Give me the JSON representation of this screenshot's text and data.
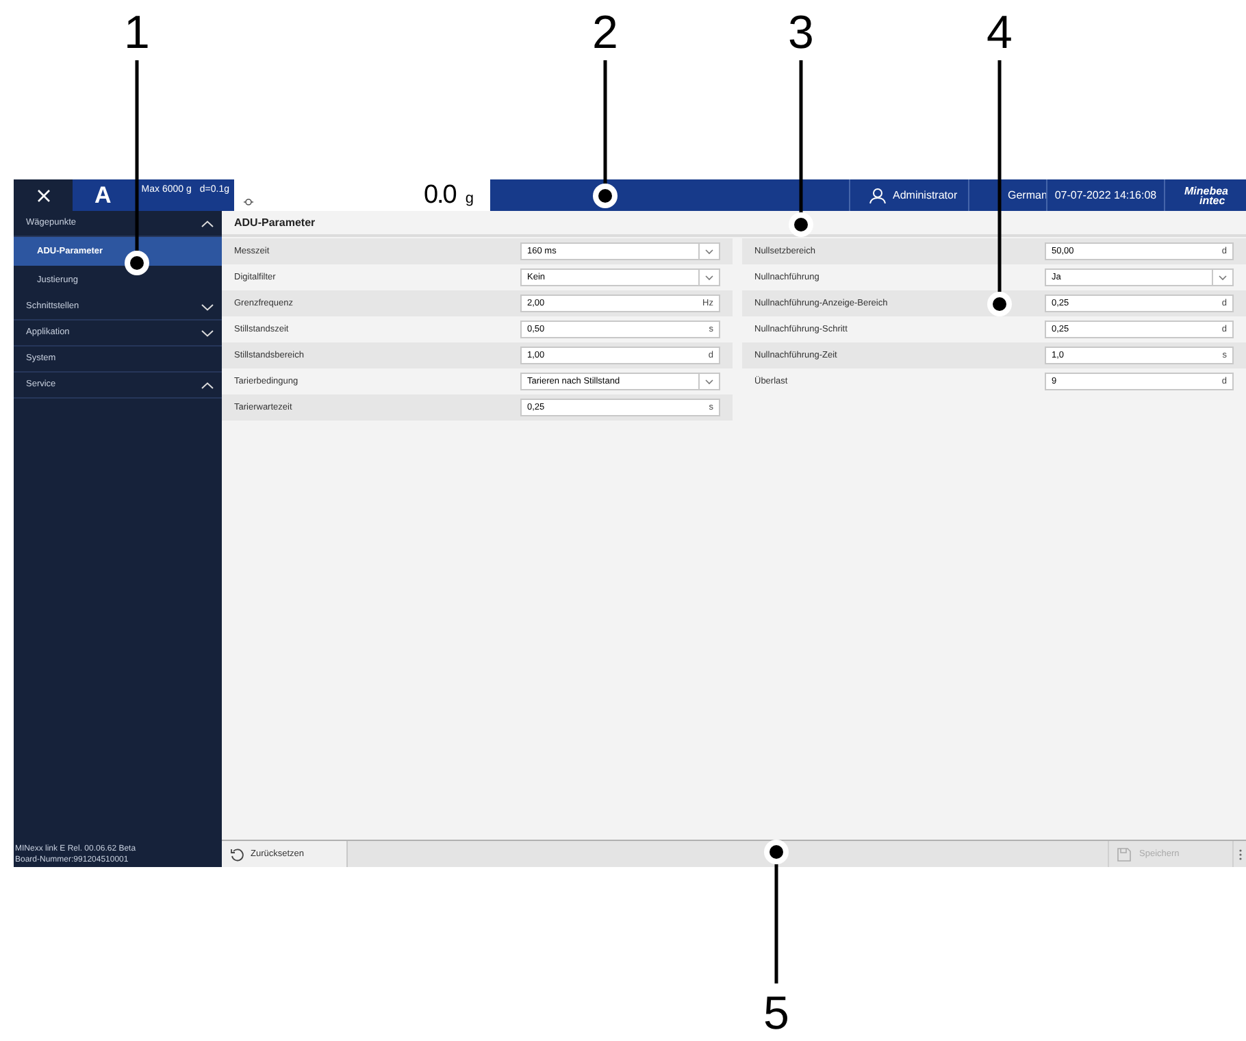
{
  "header": {
    "range_letter": "A",
    "max": "Max 6000 g",
    "division": "d=0.1g",
    "weight": "0.0",
    "unit": "g",
    "user": "Administrator",
    "language": "German",
    "datetime": "07-07-2022 14:16:08",
    "logo_line1": "Minebea",
    "logo_line2": "intec"
  },
  "sidebar": {
    "items": [
      {
        "label": "Wägepunkte",
        "expanded": true,
        "selected": false,
        "children": [
          {
            "label": "ADU-Parameter",
            "selected": true
          },
          {
            "label": "Justierung",
            "selected": false
          }
        ]
      },
      {
        "label": "Schnittstellen",
        "expanded": false,
        "selected": false
      },
      {
        "label": "Applikation",
        "expanded": false,
        "selected": false
      },
      {
        "label": "System",
        "selected": false
      },
      {
        "label": "Service",
        "expanded": true,
        "selected": false
      }
    ],
    "version": "MINexx link E Rel. 00.06.62 Beta",
    "board": "Board-Nummer:991204510001"
  },
  "panel": {
    "title": "ADU-Parameter",
    "left_rows": [
      {
        "label": "Messzeit",
        "kind": "select",
        "value": "160 ms"
      },
      {
        "label": "Digitalfilter",
        "kind": "select",
        "value": "Kein"
      },
      {
        "label": "Grenzfrequenz",
        "kind": "input",
        "value": "2,00",
        "unit": "Hz"
      },
      {
        "label": "Stillstandszeit",
        "kind": "input",
        "value": "0,50",
        "unit": "s"
      },
      {
        "label": "Stillstandsbereich",
        "kind": "input",
        "value": "1,00",
        "unit": "d"
      },
      {
        "label": "Tarierbedingung",
        "kind": "select",
        "value": "Tarieren nach Stillstand"
      },
      {
        "label": "Tarierwartezeit",
        "kind": "input",
        "value": "0,25",
        "unit": "s"
      }
    ],
    "right_rows": [
      {
        "label": "Nullsetzbereich",
        "kind": "input",
        "value": "50,00",
        "unit": "d"
      },
      {
        "label": "Nullnachführung",
        "kind": "select",
        "value": "Ja"
      },
      {
        "label": "Nullnachführung-Anzeige-Bereich",
        "kind": "input",
        "value": "0,25",
        "unit": "d"
      },
      {
        "label": "Nullnachführung-Schritt",
        "kind": "input",
        "value": "0,25",
        "unit": "d"
      },
      {
        "label": "Nullnachführung-Zeit",
        "kind": "input",
        "value": "1,0",
        "unit": "s"
      },
      {
        "label": "Überlast",
        "kind": "input",
        "value": "9",
        "unit": "d"
      }
    ]
  },
  "footer": {
    "reset": {
      "label": "Zurücksetzen",
      "disabled": false
    },
    "save": {
      "label": "Speichern",
      "disabled": true
    }
  },
  "callouts": [
    {
      "label": "1"
    },
    {
      "label": "2"
    },
    {
      "label": "3"
    },
    {
      "label": "4"
    },
    {
      "label": "5"
    }
  ]
}
